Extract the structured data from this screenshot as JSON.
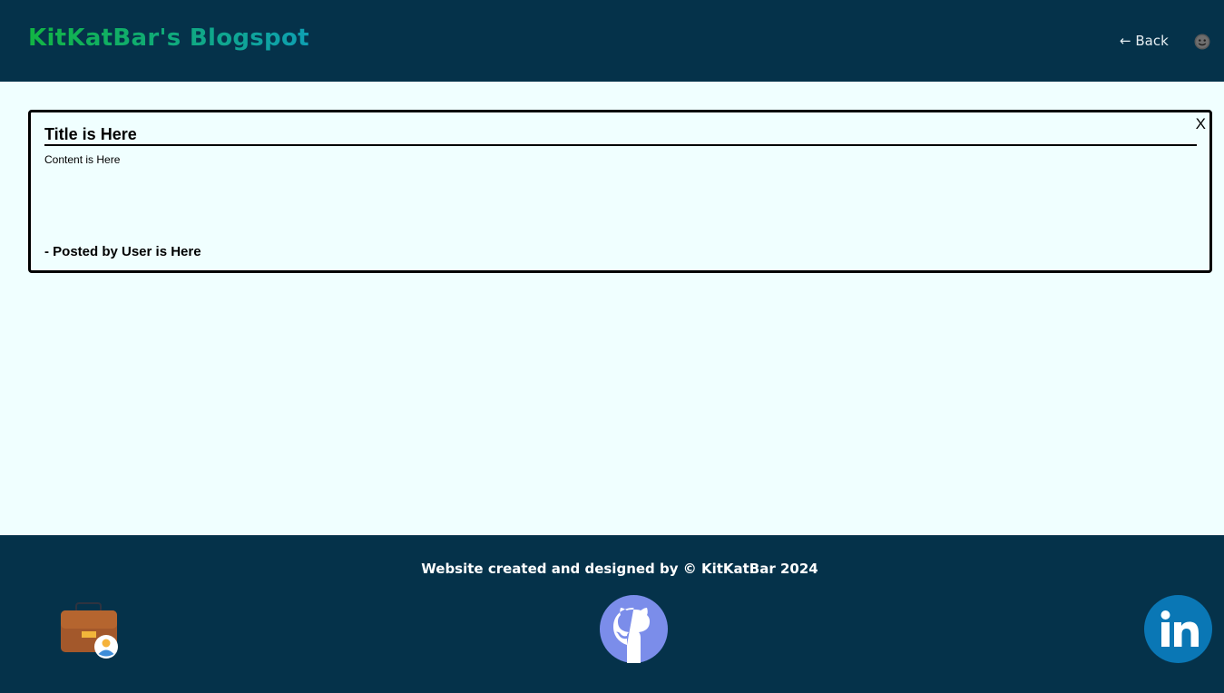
{
  "header": {
    "site_title": "KitKatBar's Blogspot",
    "back_label": "← Back",
    "avatar_icon": "user-avatar-icon",
    "background_color": "#05324A",
    "title_gradient": [
      "#12B543",
      "#0E9FB2"
    ]
  },
  "post": {
    "close_label": "X",
    "title": "Title is Here",
    "content": "Content is Here",
    "author_line": "- Posted by User is Here"
  },
  "footer": {
    "credit": "Website created and designed by © KitKatBar 2024",
    "links": [
      {
        "icon": "portfolio-briefcase-icon"
      },
      {
        "icon": "github-icon",
        "color": "#7B8DEA"
      },
      {
        "icon": "linkedin-icon",
        "color": "#0A77B5"
      }
    ]
  },
  "colors": {
    "page_background": "#F0FFFF",
    "card_border": "#000000"
  }
}
